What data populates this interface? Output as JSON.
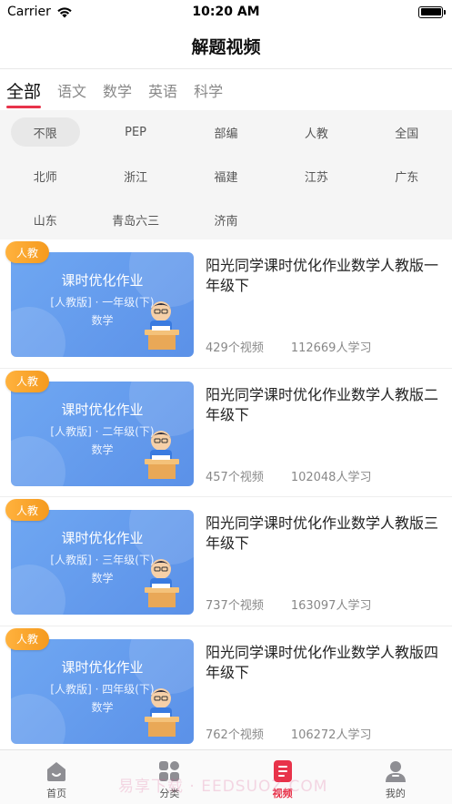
{
  "status": {
    "carrier": "Carrier",
    "time": "10:20 AM"
  },
  "nav": {
    "title": "解题视频"
  },
  "tabs": [
    {
      "label": "全部",
      "active": true
    },
    {
      "label": "语文",
      "active": false
    },
    {
      "label": "数学",
      "active": false
    },
    {
      "label": "英语",
      "active": false
    },
    {
      "label": "科学",
      "active": false
    }
  ],
  "filters": [
    "不限",
    "PEP",
    "部编",
    "人教",
    "全国",
    "北师",
    "浙江",
    "福建",
    "江苏",
    "广东",
    "山东",
    "青岛六三",
    "济南"
  ],
  "courses": [
    {
      "badge": "人教",
      "thumb_title": "课时优化作业",
      "thumb_sub": "[人教版] · 一年级(下)",
      "thumb_subject": "数学",
      "title": "阳光同学课时优化作业数学人教版一年级下",
      "videos": "429个视频",
      "learners": "112669人学习"
    },
    {
      "badge": "人教",
      "thumb_title": "课时优化作业",
      "thumb_sub": "[人教版] · 二年级(下)",
      "thumb_subject": "数学",
      "title": "阳光同学课时优化作业数学人教版二年级下",
      "videos": "457个视频",
      "learners": "102048人学习"
    },
    {
      "badge": "人教",
      "thumb_title": "课时优化作业",
      "thumb_sub": "[人教版] · 三年级(下)",
      "thumb_subject": "数学",
      "title": "阳光同学课时优化作业数学人教版三年级下",
      "videos": "737个视频",
      "learners": "163097人学习"
    },
    {
      "badge": "人教",
      "thumb_title": "课时优化作业",
      "thumb_sub": "[人教版] · 四年级(下)",
      "thumb_subject": "数学",
      "title": "阳光同学课时优化作业数学人教版四年级下",
      "videos": "762个视频",
      "learners": "106272人学习"
    }
  ],
  "tabbar": [
    {
      "label": "首页",
      "icon": "home-icon",
      "active": false
    },
    {
      "label": "分类",
      "icon": "category-icon",
      "active": false
    },
    {
      "label": "视频",
      "icon": "video-list-icon",
      "active": true
    },
    {
      "label": "我的",
      "icon": "profile-icon",
      "active": false
    }
  ],
  "watermark": "易享下载 · EEDSUOZ.COM",
  "colors": {
    "accent": "#e8334a",
    "badge": "#f59a1e",
    "thumb": "#6fa7f2"
  }
}
